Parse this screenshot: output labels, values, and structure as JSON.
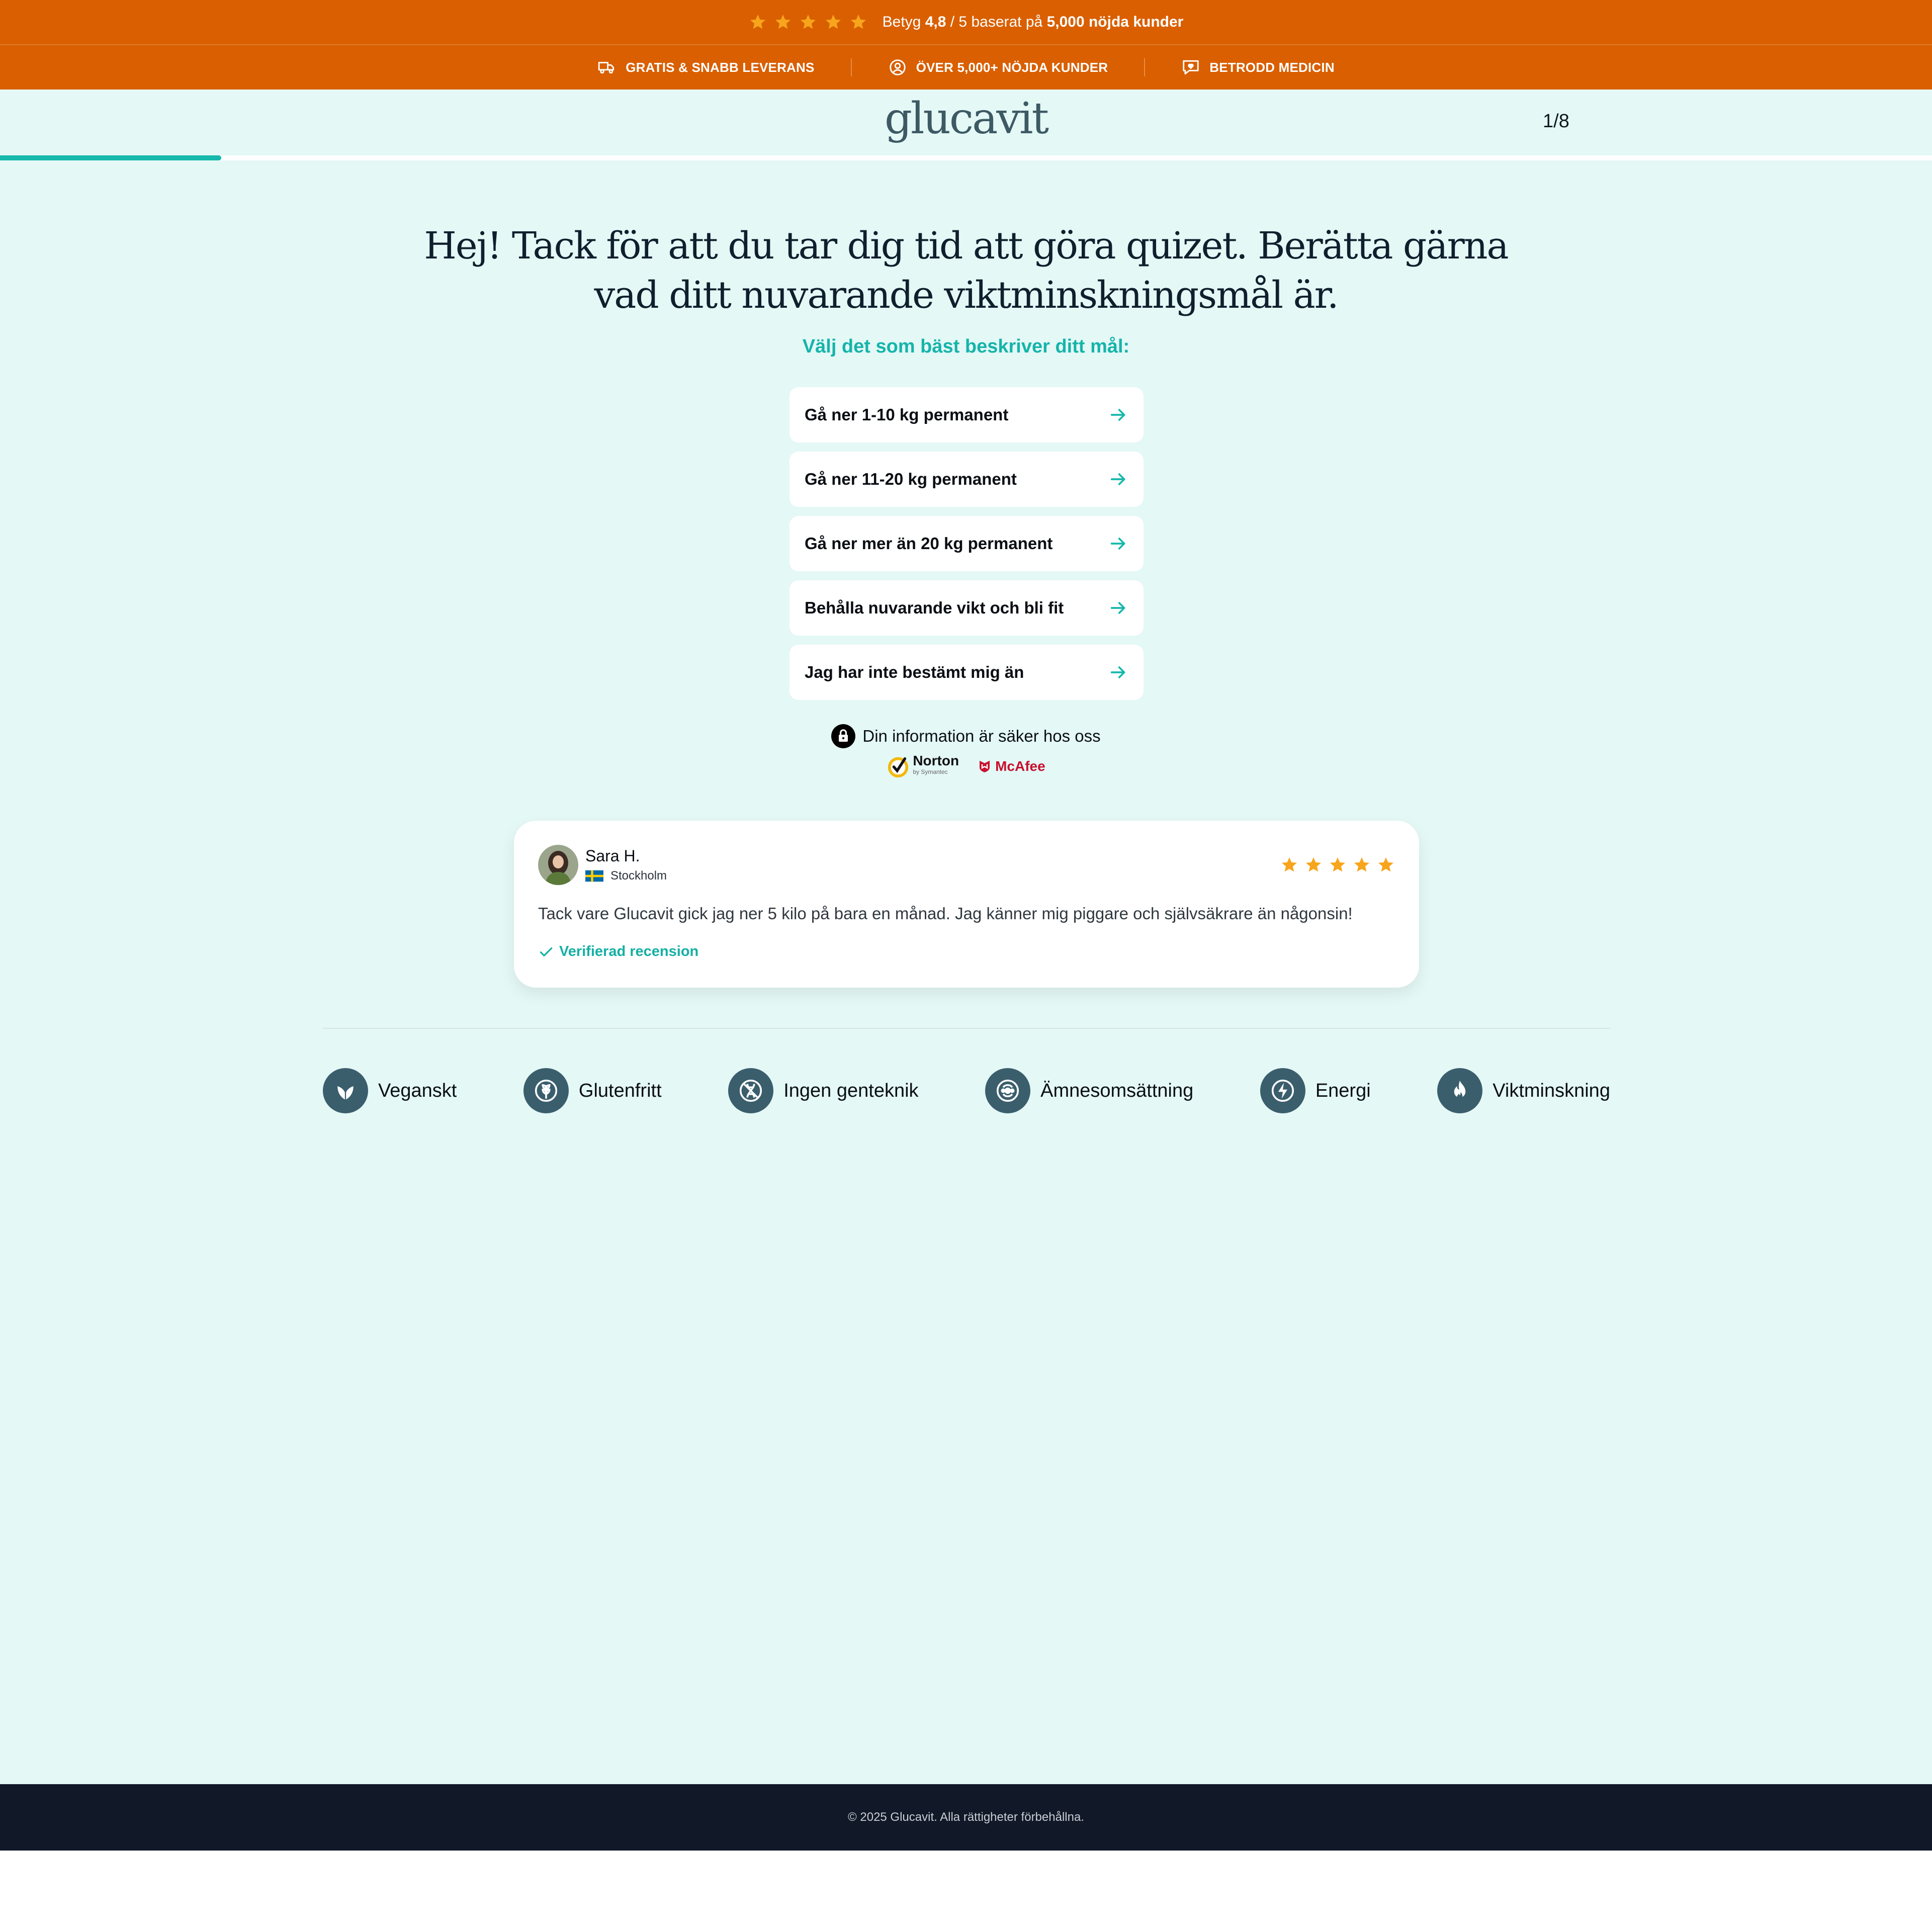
{
  "topbar": {
    "rating_prefix": "Betyg",
    "rating_value": "4,8",
    "rating_mid": "/ 5 baserat på",
    "rating_customers": "5,000 nöjda kunder",
    "stars": 5,
    "star_color": "#f7a51c",
    "bg_color": "#d95f00"
  },
  "usps": [
    {
      "icon": "truck-icon",
      "label": "GRATIS & SNABB LEVERANS"
    },
    {
      "icon": "user-circle-icon",
      "label": "ÖVER 5,000+ NÖJDA KUNDER"
    },
    {
      "icon": "chat-heart-icon",
      "label": "BETRODD MEDICIN"
    }
  ],
  "header": {
    "logo": "glucavit",
    "step": "1/8",
    "progress": 0.125,
    "accent": "#16b8ac"
  },
  "quiz": {
    "title_line1": "Hej! Tack för att du tar dig tid att göra quizet. Berätta gärna",
    "title_line2": "vad ditt nuvarande viktminskningsmål är.",
    "subtitle": "Välj det som bäst beskriver ditt mål:",
    "options": [
      "Gå ner 1-10 kg permanent",
      "Gå ner 11-20 kg permanent",
      "Gå ner mer än 20 kg permanent",
      "Behålla nuvarande vikt och bli fit",
      "Jag har inte bestämt mig än"
    ]
  },
  "security": {
    "text": "Din information är säker hos oss",
    "norton": "Norton",
    "norton_sub": "by Symantec",
    "mcafee": "McAfee"
  },
  "review": {
    "name": "Sara H.",
    "location": "Stockholm",
    "stars": 5,
    "text": "Tack vare Glucavit gick jag ner 5 kilo på bara en månad. Jag känner mig piggare och självsäkrare än någonsin!",
    "verified": "Verifierad recension"
  },
  "features": [
    {
      "icon": "leaf-icon",
      "label": "Veganskt"
    },
    {
      "icon": "wheat-icon",
      "label": "Glutenfritt"
    },
    {
      "icon": "no-gmo-icon",
      "label": "Ingen genteknik"
    },
    {
      "icon": "metabolism-icon",
      "label": "Ämnesomsättning"
    },
    {
      "icon": "lightning-icon",
      "label": "Energi"
    },
    {
      "icon": "flame-icon",
      "label": "Viktminskning"
    }
  ],
  "footer": {
    "copyright": "© 2025 Glucavit. Alla rättigheter förbehållna."
  }
}
